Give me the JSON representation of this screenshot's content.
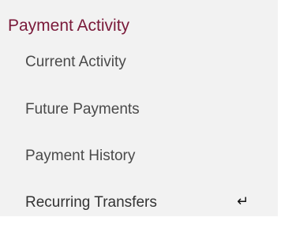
{
  "menu": {
    "section_title": "Payment Activity",
    "items": [
      {
        "label": "Current Activity"
      },
      {
        "label": "Future Payments"
      },
      {
        "label": "Payment History"
      },
      {
        "label": "Recurring Transfers",
        "active": true,
        "icon": "return-arrow-icon"
      }
    ],
    "colors": {
      "section_title": "#7a1a3a",
      "panel_background": "#f2f2f2",
      "item_text": "#4a4a4a"
    }
  }
}
